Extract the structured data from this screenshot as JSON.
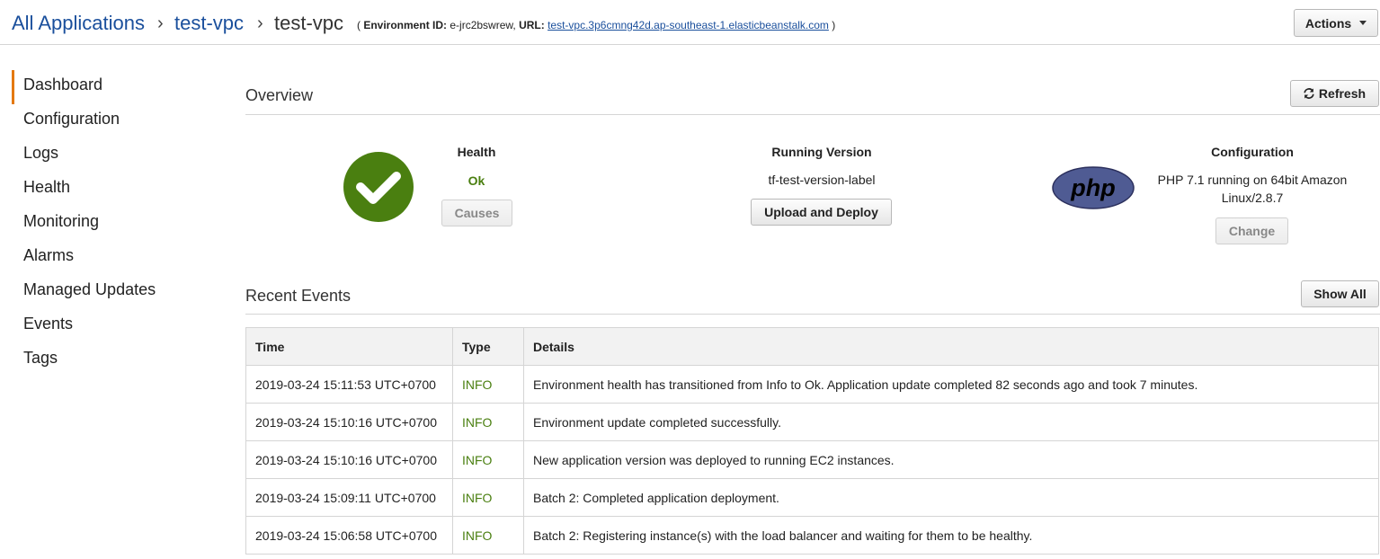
{
  "breadcrumb": {
    "all_apps": "All Applications",
    "sep1": "›",
    "app": "test-vpc",
    "sep2": "›",
    "env": "test-vpc"
  },
  "env_info": {
    "open": "( ",
    "env_id_label": "Environment ID:",
    "env_id": "e-jrc2bswrew,",
    "url_label": "URL:",
    "url": "test-vpc.3p6cmng42d.ap-southeast-1.elasticbeanstalk.com",
    "close": " )"
  },
  "actions_label": "Actions",
  "sidebar": {
    "items": [
      {
        "label": "Dashboard"
      },
      {
        "label": "Configuration"
      },
      {
        "label": "Logs"
      },
      {
        "label": "Health"
      },
      {
        "label": "Monitoring"
      },
      {
        "label": "Alarms"
      },
      {
        "label": "Managed Updates"
      },
      {
        "label": "Events"
      },
      {
        "label": "Tags"
      }
    ],
    "active_index": 0
  },
  "overview": {
    "title": "Overview",
    "refresh_label": "Refresh",
    "health": {
      "heading": "Health",
      "status": "Ok",
      "causes_label": "Causes"
    },
    "running_version": {
      "heading": "Running Version",
      "label": "tf-test-version-label",
      "button": "Upload and Deploy"
    },
    "configuration": {
      "heading": "Configuration",
      "line1": "PHP 7.1 running on 64bit Amazon",
      "line2": "Linux/2.8.7",
      "button": "Change",
      "logo_text": "php"
    }
  },
  "events": {
    "title": "Recent Events",
    "show_all_label": "Show All",
    "columns": [
      "Time",
      "Type",
      "Details"
    ],
    "rows": [
      {
        "time": "2019-03-24 15:11:53 UTC+0700",
        "type": "INFO",
        "details": "Environment health has transitioned from Info to Ok. Application update completed 82 seconds ago and took 7 minutes."
      },
      {
        "time": "2019-03-24 15:10:16 UTC+0700",
        "type": "INFO",
        "details": "Environment update completed successfully."
      },
      {
        "time": "2019-03-24 15:10:16 UTC+0700",
        "type": "INFO",
        "details": "New application version was deployed to running EC2 instances."
      },
      {
        "time": "2019-03-24 15:09:11 UTC+0700",
        "type": "INFO",
        "details": "Batch 2: Completed application deployment."
      },
      {
        "time": "2019-03-24 15:06:58 UTC+0700",
        "type": "INFO",
        "details": "Batch 2: Registering instance(s) with the load balancer and waiting for them to be healthy."
      }
    ]
  },
  "colors": {
    "link": "#1a4f9c",
    "ok_green": "#4a7f10",
    "active_accent": "#e47911",
    "php_purple": "#4f5b93"
  }
}
